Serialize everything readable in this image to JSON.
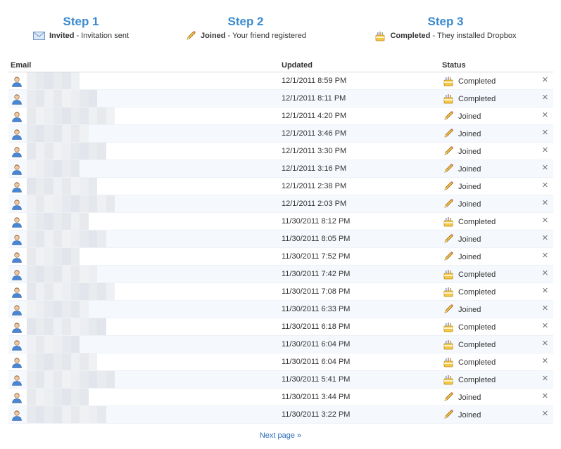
{
  "steps": [
    {
      "title": "Step 1",
      "bold": "Invited",
      "sep": "-",
      "desc": "Invitation sent",
      "icon": "envelope-icon"
    },
    {
      "title": "Step 2",
      "bold": "Joined",
      "sep": "-",
      "desc": "Your friend registered",
      "icon": "pencil-icon"
    },
    {
      "title": "Step 3",
      "bold": "Completed",
      "sep": "-",
      "desc": "They installed Dropbox",
      "icon": "cake-icon"
    }
  ],
  "table": {
    "headers": {
      "email": "Email",
      "updated": "Updated",
      "status": "Status"
    },
    "remove_glyph": "×",
    "rows": [
      {
        "updated": "12/1/2011 8:59 PM",
        "status": "Completed"
      },
      {
        "updated": "12/1/2011 8:11 PM",
        "status": "Completed"
      },
      {
        "updated": "12/1/2011 4:20 PM",
        "status": "Joined"
      },
      {
        "updated": "12/1/2011 3:46 PM",
        "status": "Joined"
      },
      {
        "updated": "12/1/2011 3:30 PM",
        "status": "Joined"
      },
      {
        "updated": "12/1/2011 3:16 PM",
        "status": "Joined"
      },
      {
        "updated": "12/1/2011 2:38 PM",
        "status": "Joined"
      },
      {
        "updated": "12/1/2011 2:03 PM",
        "status": "Joined"
      },
      {
        "updated": "11/30/2011 8:12 PM",
        "status": "Completed"
      },
      {
        "updated": "11/30/2011 8:05 PM",
        "status": "Joined"
      },
      {
        "updated": "11/30/2011 7:52 PM",
        "status": "Joined"
      },
      {
        "updated": "11/30/2011 7:42 PM",
        "status": "Completed"
      },
      {
        "updated": "11/30/2011 7:08 PM",
        "status": "Completed"
      },
      {
        "updated": "11/30/2011 6:33 PM",
        "status": "Joined"
      },
      {
        "updated": "11/30/2011 6:18 PM",
        "status": "Completed"
      },
      {
        "updated": "11/30/2011 6:04 PM",
        "status": "Completed"
      },
      {
        "updated": "11/30/2011 6:04 PM",
        "status": "Completed"
      },
      {
        "updated": "11/30/2011 5:41 PM",
        "status": "Completed"
      },
      {
        "updated": "11/30/2011 3:44 PM",
        "status": "Joined"
      },
      {
        "updated": "11/30/2011 3:22 PM",
        "status": "Joined"
      }
    ]
  },
  "pagination": {
    "next_label": "Next page »"
  },
  "colors": {
    "accent": "#3a8ad0",
    "link": "#2a6cb6",
    "row_alt": "#f5f8fc"
  }
}
